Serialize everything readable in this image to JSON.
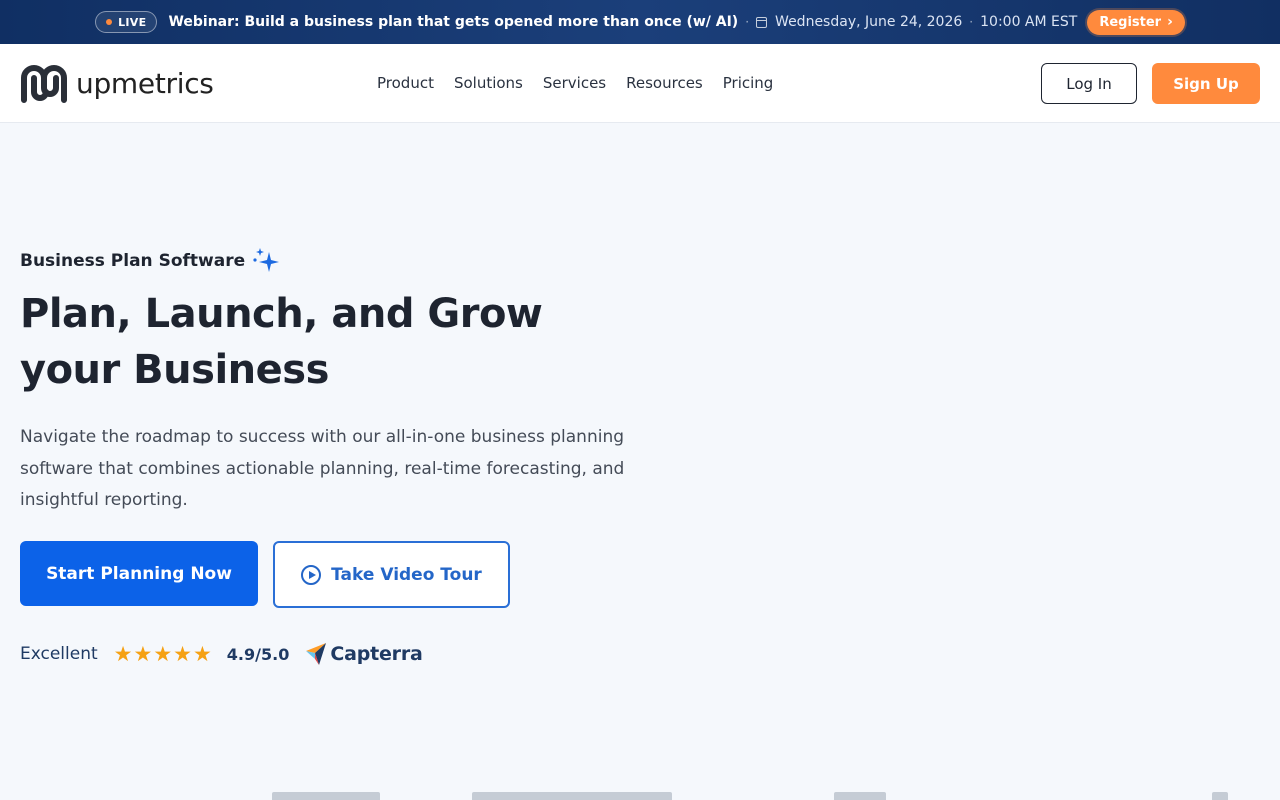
{
  "announcement": {
    "live_label": "LIVE",
    "webinar_title": "Webinar: Build a business plan that gets opened more than once (w/ AI)",
    "date": "Wednesday, June 24, 2026",
    "time": "10:00 AM EST",
    "register_label": "Register",
    "separator": "·"
  },
  "header": {
    "logo_text": "upmetrics",
    "nav": [
      {
        "label": "Product"
      },
      {
        "label": "Solutions"
      },
      {
        "label": "Services"
      },
      {
        "label": "Resources"
      },
      {
        "label": "Pricing"
      }
    ],
    "login_label": "Log In",
    "signup_label": "Sign Up"
  },
  "hero": {
    "eyebrow": "Business Plan Software",
    "title": "Plan, Launch, and Grow your Business",
    "description": "Navigate the roadmap to success with our all-in-one business planning software that combines actionable planning, real-time forecasting, and insightful reporting.",
    "primary_cta": "Start Planning Now",
    "secondary_cta": "Take Video Tour"
  },
  "rating": {
    "label": "Excellent",
    "stars": 5,
    "score": "4.9/5.0",
    "provider": "Capterra"
  },
  "colors": {
    "brand_orange": "#ff8a3d",
    "primary_blue": "#0c62e8",
    "navy": "#102f63"
  }
}
